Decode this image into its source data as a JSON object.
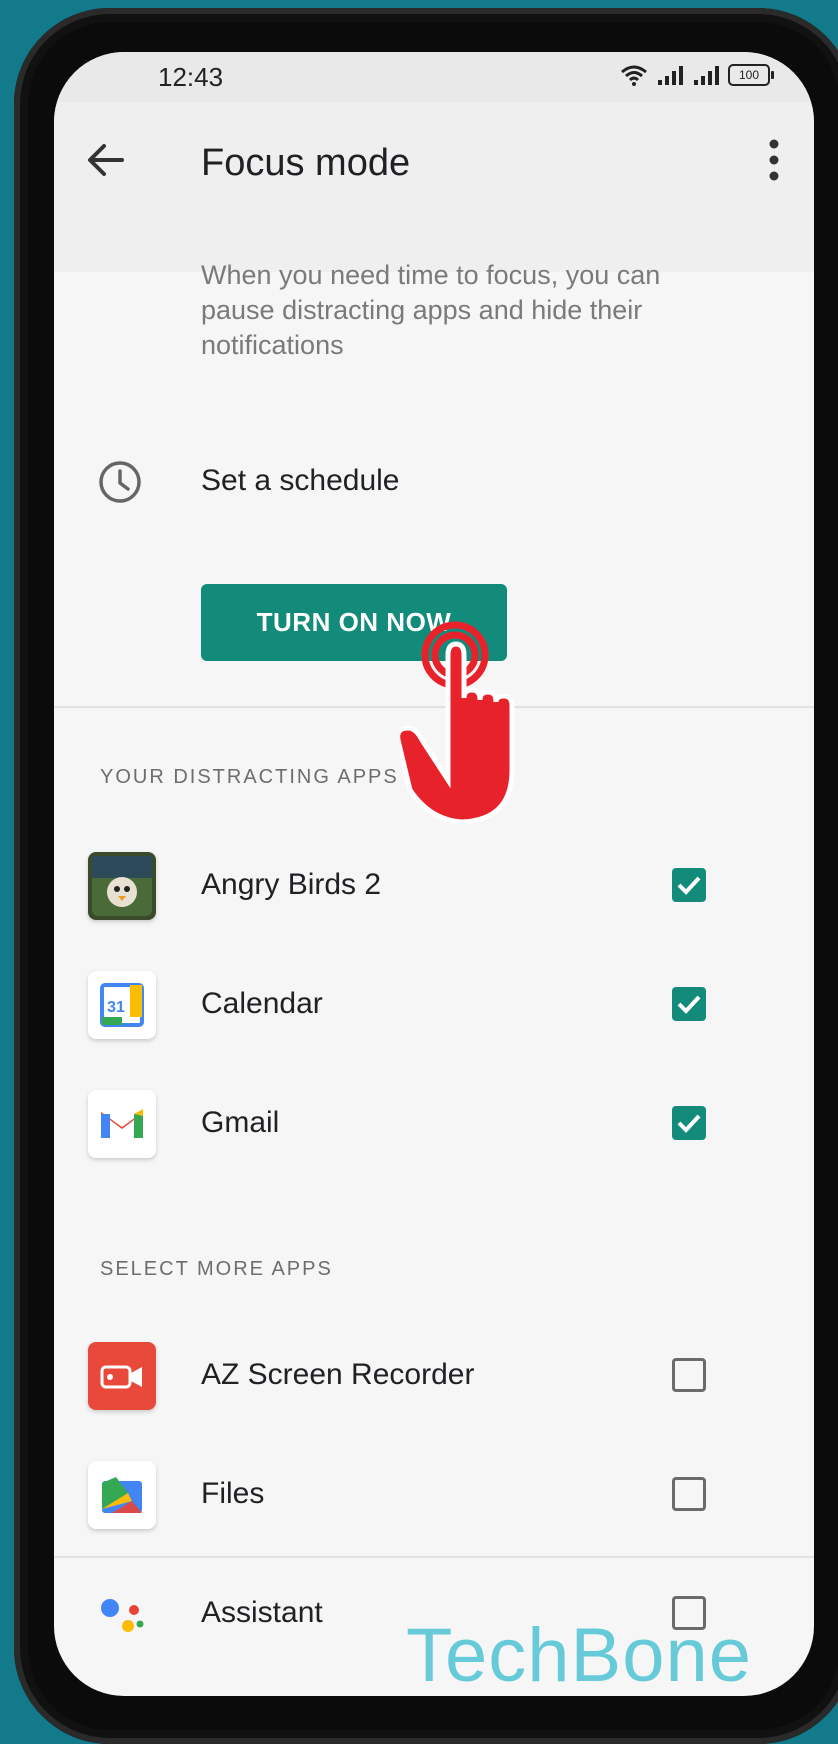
{
  "status_bar": {
    "time": "12:43",
    "battery": "100"
  },
  "app_bar": {
    "title": "Focus mode"
  },
  "description": "When you need time to focus, you can pause distracting apps and hide their notifications",
  "schedule": {
    "label": "Set a schedule"
  },
  "turn_on_button": {
    "label": "TURN ON NOW"
  },
  "sections": {
    "distracting": "YOUR DISTRACTING APPS",
    "more": "SELECT MORE APPS"
  },
  "distracting_apps": [
    {
      "name": "Angry Birds 2",
      "checked": true,
      "icon": "angry-birds-icon"
    },
    {
      "name": "Calendar",
      "checked": true,
      "icon": "calendar-icon"
    },
    {
      "name": "Gmail",
      "checked": true,
      "icon": "gmail-icon"
    }
  ],
  "more_apps": [
    {
      "name": "AZ Screen Recorder",
      "checked": false,
      "icon": "az-screen-recorder-icon"
    },
    {
      "name": "Files",
      "checked": false,
      "icon": "files-icon"
    },
    {
      "name": "Assistant",
      "checked": false,
      "icon": "assistant-icon"
    }
  ],
  "calendar_icon_number": "31",
  "watermark": "TechBone",
  "colors": {
    "accent": "#138b7b",
    "background": "#127a8a",
    "hand": "#e8222a"
  }
}
